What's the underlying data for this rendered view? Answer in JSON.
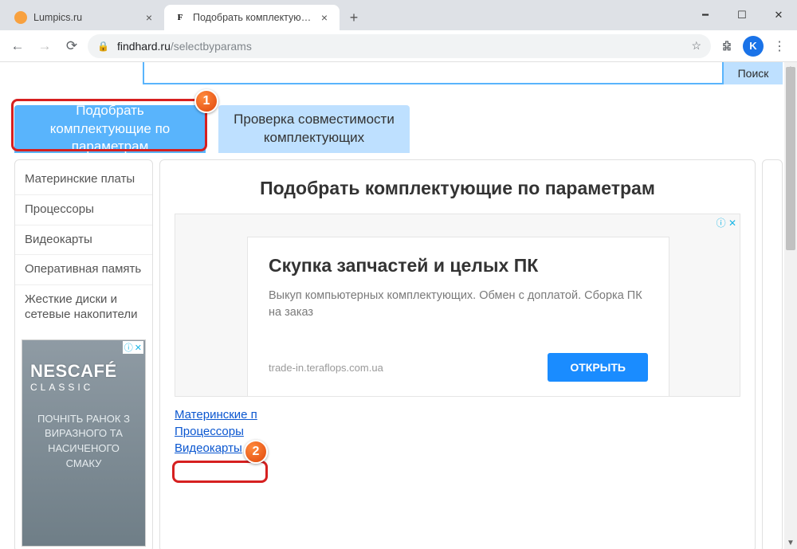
{
  "window": {
    "tabs": [
      {
        "title": "Lumpics.ru",
        "favicon_bg": "#f8a13f",
        "favicon_text": "",
        "active": false
      },
      {
        "title": "Подобрать комплектующие по",
        "favicon_bg": "#ffffff",
        "favicon_text": "F",
        "active": true
      }
    ]
  },
  "toolbar": {
    "url_host": "findhard.ru",
    "url_path": "/selectbyparams",
    "avatar_letter": "K"
  },
  "search_button": "Поиск",
  "bigtabs": {
    "active": "Подобрать комплектующие по параметрам",
    "other": "Проверка совместимости комплектующих"
  },
  "sidebar": {
    "items": [
      "Материнские платы",
      "Процессоры",
      "Видеокарты",
      "Оперативная память",
      "Жесткие диски и сетевые накопители"
    ],
    "ad": {
      "logo_line1": "NESCAFÉ",
      "logo_line2": "CLASSIC",
      "text": "ПОЧНІТЬ РАНОК З ВИРАЗНОГО ТА НАСИЧЕНОГО СМАКУ"
    }
  },
  "main": {
    "heading": "Подобрать комплектующие по параметрам",
    "ad": {
      "title": "Скупка запчастей и целых ПК",
      "desc": "Выкуп компьютерных комплектующих. Обмен с доплатой. Сборка ПК на заказ",
      "domain": "trade-in.teraflops.com.ua",
      "cta": "ОТКРЫТЬ"
    },
    "links": [
      "Материнские п",
      "Процессоры",
      "Видеокарты"
    ]
  },
  "annotations": {
    "badge1": "1",
    "badge2": "2"
  }
}
